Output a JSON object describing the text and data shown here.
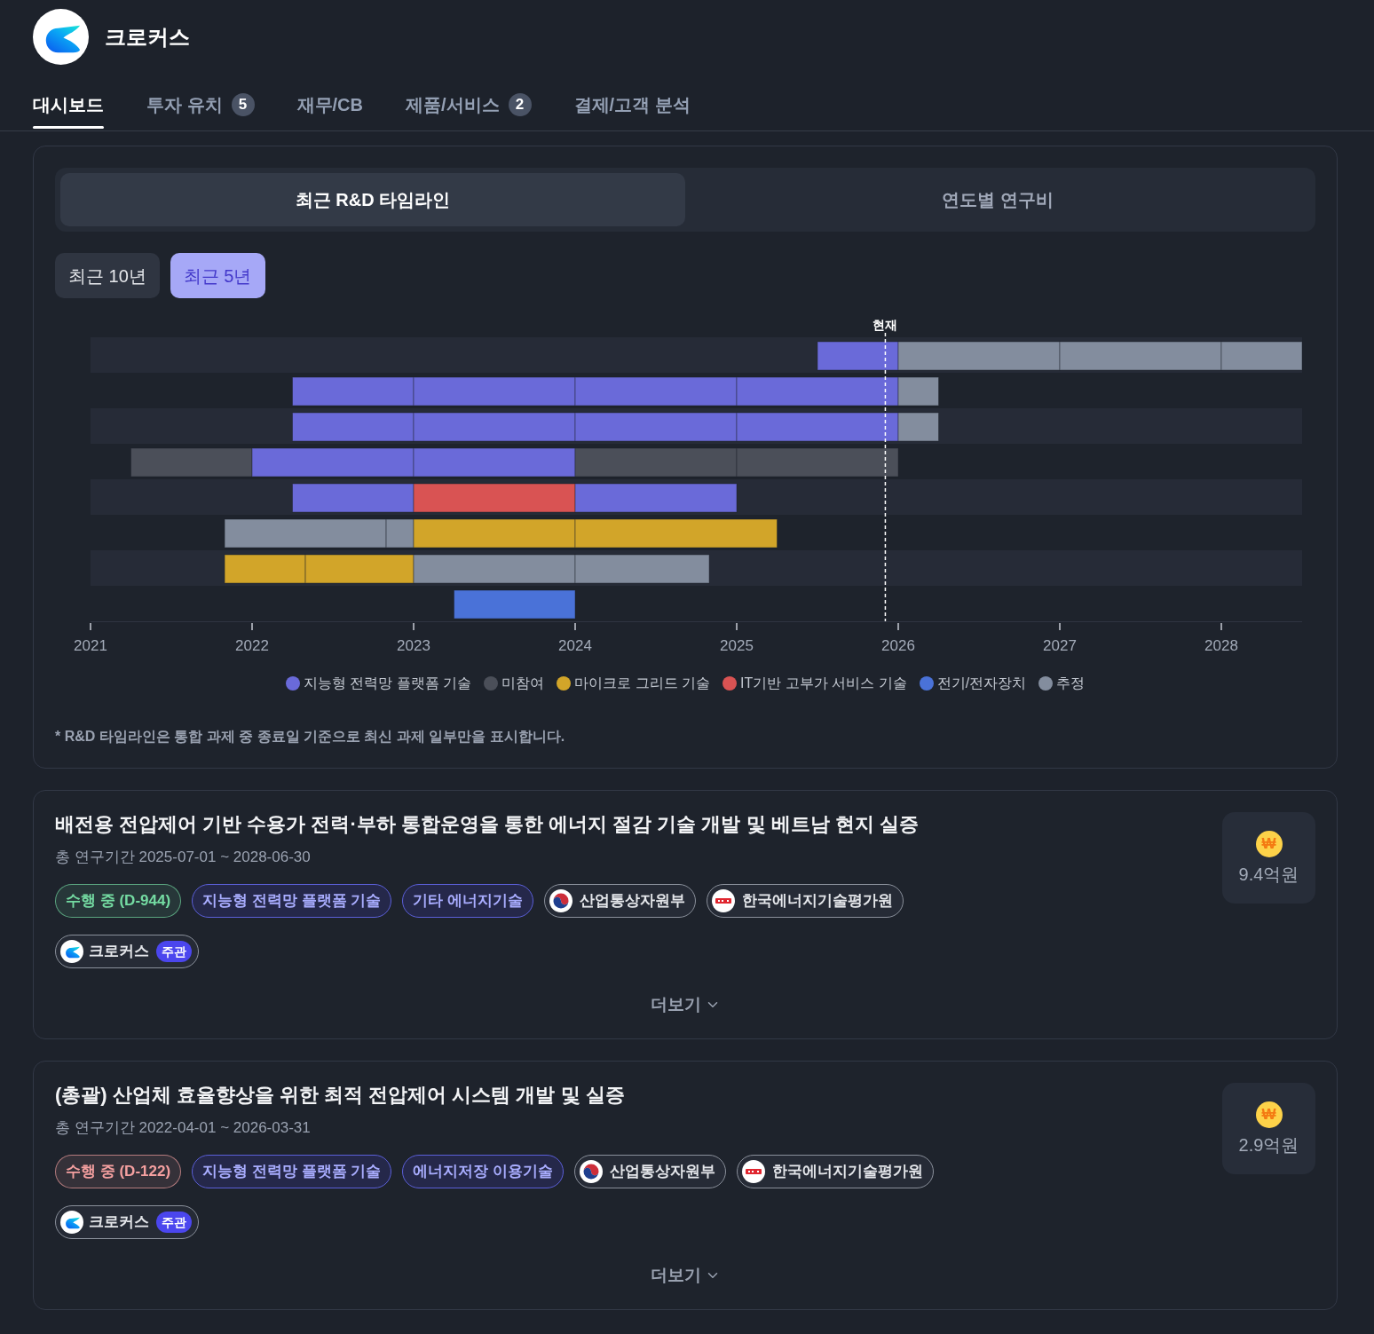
{
  "app": {
    "name": "크로커스"
  },
  "tabs": [
    {
      "label": "대시보드",
      "selected": true
    },
    {
      "label": "투자 유치",
      "count": "5",
      "selected": false
    },
    {
      "label": "재무/CB",
      "selected": false
    },
    {
      "label": "제품/서비스",
      "count": "2",
      "selected": false
    },
    {
      "label": "결제/고객 분석",
      "selected": false
    }
  ],
  "timeline_panel": {
    "view_tabs": [
      {
        "label": "최근 R&D 타임라인",
        "selected": true
      },
      {
        "label": "연도별 연구비",
        "selected": false
      }
    ],
    "periods": [
      {
        "label": "최근 10년",
        "selected": false
      },
      {
        "label": "최근 5년",
        "selected": true
      }
    ],
    "timeline": {
      "now_label": "현재",
      "year_labels": [
        "2021",
        "2022",
        "2023",
        "2024",
        "2025",
        "2026",
        "2027",
        "2028"
      ]
    },
    "legend": [
      {
        "label": "지능형 전력망 플랫폼 기술",
        "color": "#6a6ad9"
      },
      {
        "label": "미참여",
        "color": "#4b4f59"
      },
      {
        "label": "마이크로 그리드 기술",
        "color": "#d2a529"
      },
      {
        "label": "IT기반 고부가 서비스 기술",
        "color": "#d95353"
      },
      {
        "label": "전기/전자장치",
        "color": "#4a72d8"
      },
      {
        "label": "추정",
        "color": "#838d9e"
      }
    ],
    "footnote": "* R&D 타임라인은 통합 과제 중 종료일 기준으로 최신 과제 일부만을 표시합니다."
  },
  "projects": [
    {
      "title": "배전용 전압제어 기반 수용가 전력·부하 통합운영을 통한 에너지 절감 기술 개발 및 베트남 현지 실증",
      "period": "총 연구기간 2025-07-01 ~ 2028-06-30",
      "tags": [
        {
          "kind": "status",
          "label": "수행 중 (D-944)",
          "color": "#74dba2"
        },
        {
          "kind": "field",
          "label": "지능형 전력망 플랫폼 기술"
        },
        {
          "kind": "field",
          "label": "기타 에너지기술"
        },
        {
          "kind": "ministry",
          "label": "산업통상자원부"
        },
        {
          "kind": "agency",
          "label": "한국에너지기술평가원"
        }
      ],
      "lead": {
        "label": "크로커스",
        "role": "주관"
      },
      "amount": {
        "symbol": "₩",
        "value": "9.4억원"
      },
      "more": "더보기"
    },
    {
      "title": "(총괄) 산업체 효율향상을 위한 최적 전압제어 시스템 개발 및 실증",
      "period": "총 연구기간 2022-04-01 ~ 2026-03-31",
      "tags": [
        {
          "kind": "status",
          "label": "수행 중 (D-122)",
          "color": "#f5a0a0"
        },
        {
          "kind": "field",
          "label": "지능형 전력망 플랫폼 기술"
        },
        {
          "kind": "field",
          "label": "에너지저장 이용기술"
        },
        {
          "kind": "ministry",
          "label": "산업통상자원부"
        },
        {
          "kind": "agency",
          "label": "한국에너지기술평가원"
        }
      ],
      "lead": {
        "label": "크로커스",
        "role": "주관"
      },
      "amount": {
        "symbol": "₩",
        "value": "2.9억원"
      },
      "more": "더보기"
    }
  ]
}
